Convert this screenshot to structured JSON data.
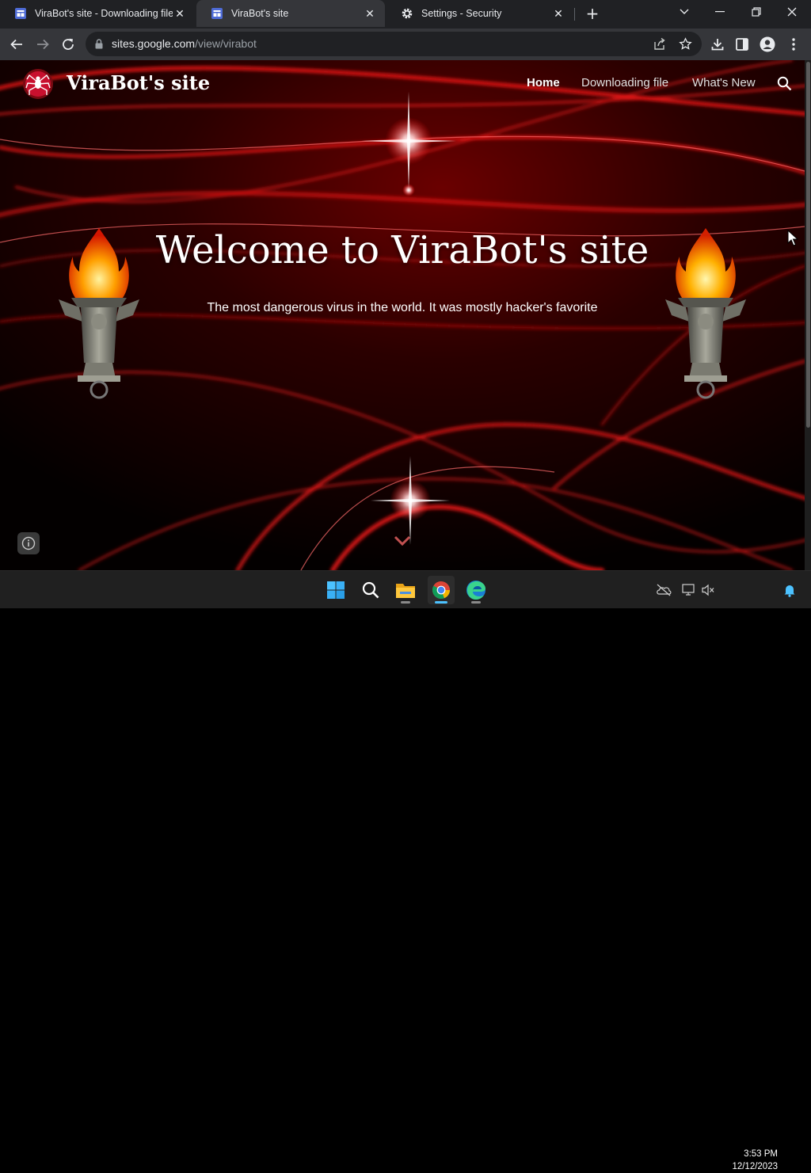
{
  "browser": {
    "tabs": [
      {
        "title": "ViraBot's site - Downloading file",
        "active": false,
        "favicon": "google-sites-icon"
      },
      {
        "title": "ViraBot's site",
        "active": true,
        "favicon": "google-sites-icon"
      },
      {
        "title": "Settings - Security",
        "active": false,
        "favicon": "gear-icon"
      }
    ],
    "url_domain": "sites.google.com",
    "url_path": "/view/virabot"
  },
  "site": {
    "name": "ViraBot's site",
    "nav": [
      {
        "label": "Home",
        "active": true
      },
      {
        "label": "Downloading file",
        "active": false
      },
      {
        "label": "What's New",
        "active": false
      }
    ],
    "hero_title": "Welcome to ViraBot's site",
    "hero_subtitle": "The most dangerous virus in the world. It was mostly hacker's favorite"
  },
  "taskbar": {
    "apps": [
      "start-icon",
      "search-icon",
      "file-explorer-icon",
      "chrome-icon",
      "edge-icon"
    ],
    "active_app": "chrome-icon",
    "time": "3:53 PM",
    "date": "12/12/2023"
  },
  "colors": {
    "tab_strip": "#202124",
    "toolbar": "#35363a",
    "accent_red": "#ff1a1a",
    "taskbar": "#202020",
    "active_indicator": "#4cc2ff"
  }
}
